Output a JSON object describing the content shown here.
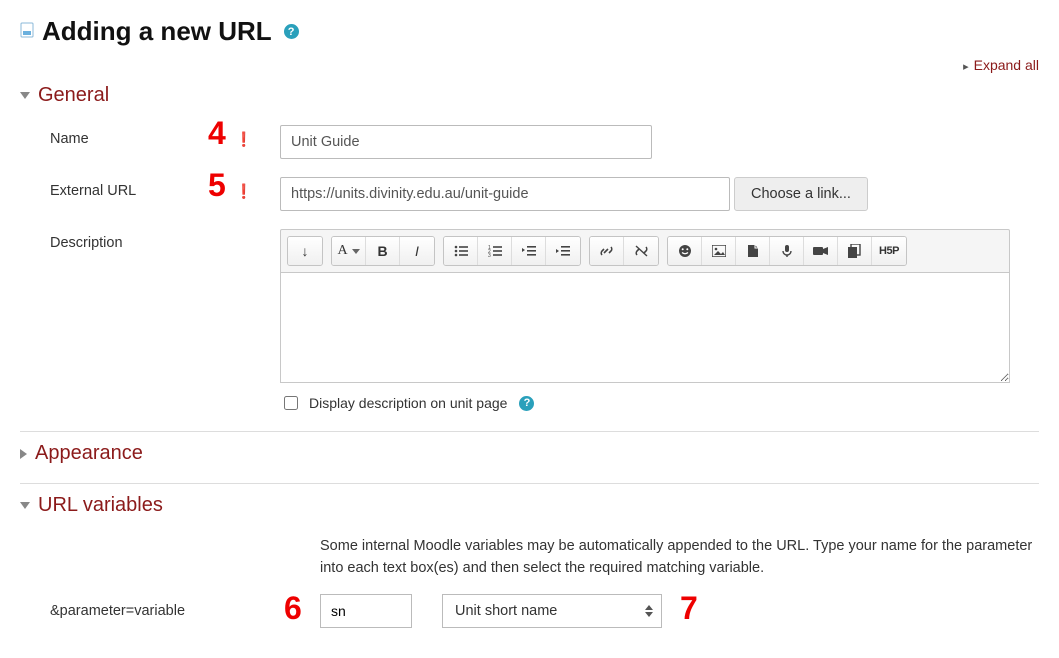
{
  "page": {
    "title": "Adding a new URL",
    "expand_all": "Expand all"
  },
  "sections": {
    "general": {
      "title": "General",
      "expanded": true
    },
    "appearance": {
      "title": "Appearance",
      "expanded": false
    },
    "url_variables": {
      "title": "URL variables",
      "expanded": true
    }
  },
  "general": {
    "name_label": "Name",
    "name_value": "Unit Guide",
    "url_label": "External URL",
    "url_value": "https://units.divinity.edu.au/unit-guide",
    "choose_link_label": "Choose a link...",
    "description_label": "Description",
    "display_desc_label": "Display description on unit page"
  },
  "editor_toolbar": {
    "toggle": "↓",
    "font": "A",
    "bold": "B",
    "italic": "I",
    "ul": "bullet-list",
    "ol": "number-list",
    "outdent": "outdent",
    "indent": "indent",
    "link": "link",
    "unlink": "unlink",
    "emoji": "emoji",
    "image": "image",
    "file": "file",
    "mic": "mic",
    "video": "video",
    "copy": "copy",
    "h5p": "H5P"
  },
  "url_variables": {
    "description": "Some internal Moodle variables may be automatically appended to the URL. Type your name for the parameter into each text box(es) and then select the required matching variable.",
    "param_label": "&parameter=variable",
    "param_name": "sn",
    "param_variable": "Unit short name"
  },
  "annotations": {
    "4": "4",
    "5": "5",
    "6": "6",
    "7": "7"
  }
}
